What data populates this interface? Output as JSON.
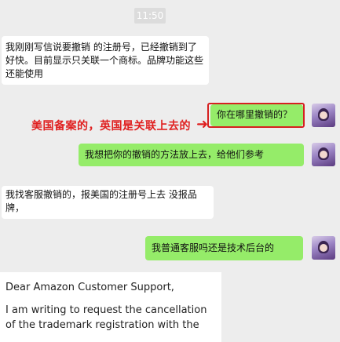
{
  "chat": {
    "time": "11:50",
    "messages": [
      {
        "id": "m1",
        "side": "in",
        "text": "我刚刚写信说要撤销 的注册号，已经撤销到了 好快。目前显示只关联一个商标。品牌功能这些还能使用"
      },
      {
        "id": "m2",
        "side": "out",
        "text": "你在哪里撤销的？"
      },
      {
        "id": "m3",
        "side": "out",
        "text": "我想把你的撤销的方法放上去，给他们参考"
      },
      {
        "id": "m4",
        "side": "in",
        "text": "我找客服撤销的，报美国的注册号上去 没报品牌，"
      },
      {
        "id": "m5",
        "side": "out",
        "text": "我普通客服吗还是技术后台的"
      }
    ],
    "annotation": "美国备案的，英国是关联上去的",
    "email": {
      "greeting": "Dear Amazon Customer Support,",
      "body": "I am writing to request the cancellation of the trademark registration with the"
    }
  }
}
